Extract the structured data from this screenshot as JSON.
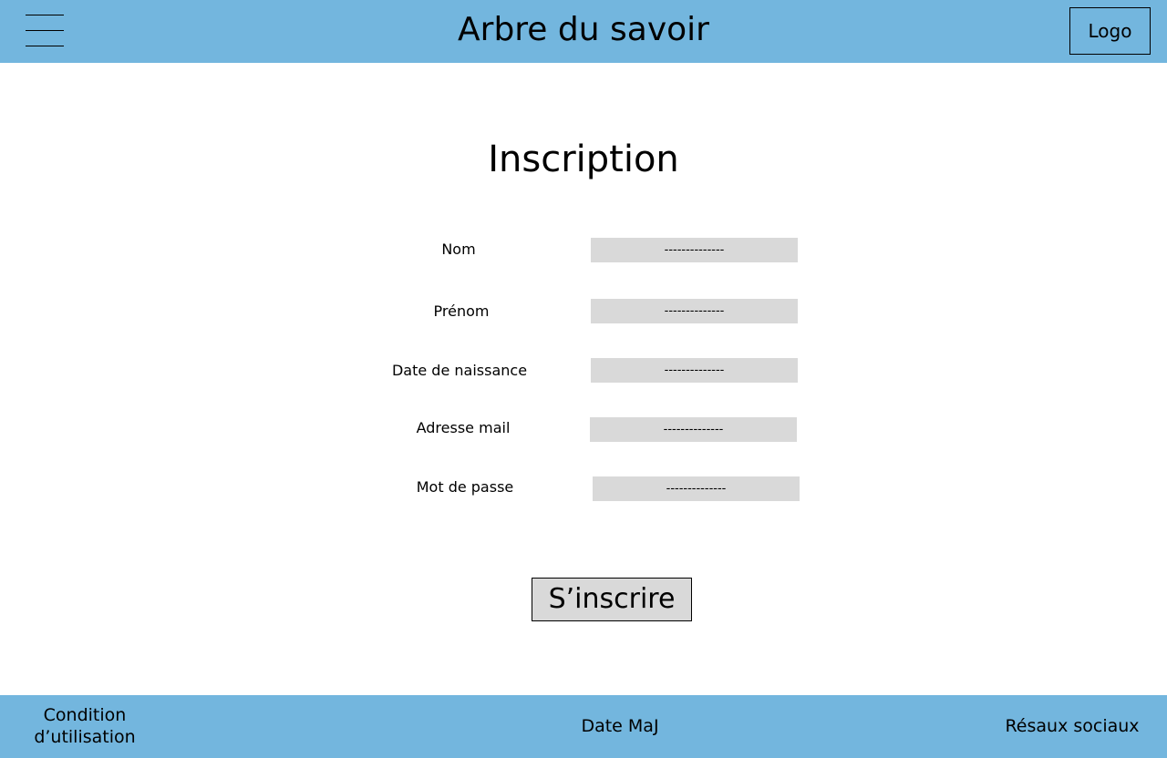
{
  "header": {
    "title": "Arbre du savoir",
    "logo_label": "Logo",
    "menu_icon": "hamburger-menu-icon"
  },
  "main": {
    "title": "Inscription",
    "fields": [
      {
        "label": "Nom",
        "value": "--------------"
      },
      {
        "label": "Prénom",
        "value": "--------------"
      },
      {
        "label": "Date de naissance",
        "value": "--------------"
      },
      {
        "label": "Adresse mail",
        "value": "--------------"
      },
      {
        "label": "Mot de passe",
        "value": "--------------"
      }
    ],
    "submit_label": "S’inscrire"
  },
  "footer": {
    "terms": "Condition d’utilisation",
    "date": "Date MaJ",
    "social": "Résaux sociaux"
  },
  "colors": {
    "header_footer_bg": "#73b6de",
    "input_bg": "#d9d9d9"
  }
}
